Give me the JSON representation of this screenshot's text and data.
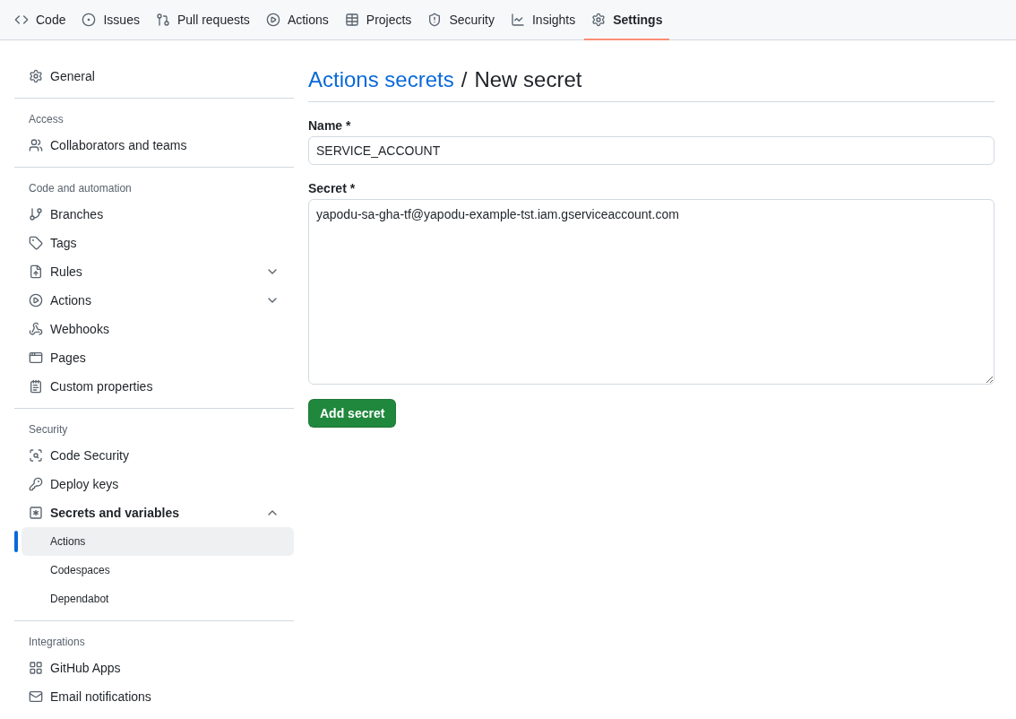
{
  "tabs": [
    {
      "label": "Code",
      "selected": false
    },
    {
      "label": "Issues",
      "selected": false
    },
    {
      "label": "Pull requests",
      "selected": false
    },
    {
      "label": "Actions",
      "selected": false
    },
    {
      "label": "Projects",
      "selected": false
    },
    {
      "label": "Security",
      "selected": false
    },
    {
      "label": "Insights",
      "selected": false
    },
    {
      "label": "Settings",
      "selected": true
    }
  ],
  "sidebar": {
    "sections": [
      {
        "items": [
          {
            "label": "General",
            "selected": false
          }
        ]
      },
      {
        "heading": "Access",
        "items": [
          {
            "label": "Collaborators and teams",
            "selected": false
          }
        ]
      },
      {
        "heading": "Code and automation",
        "items": [
          {
            "label": "Branches",
            "selected": false
          },
          {
            "label": "Tags",
            "selected": false
          },
          {
            "label": "Rules",
            "selected": false,
            "expanded": false
          },
          {
            "label": "Actions",
            "selected": false,
            "expanded": false
          },
          {
            "label": "Webhooks",
            "selected": false
          },
          {
            "label": "Pages",
            "selected": false
          },
          {
            "label": "Custom properties",
            "selected": false
          }
        ]
      },
      {
        "heading": "Security",
        "items": [
          {
            "label": "Code Security",
            "selected": false
          },
          {
            "label": "Deploy keys",
            "selected": false
          },
          {
            "label": "Secrets and variables",
            "selected": false,
            "expanded": true,
            "children": [
              {
                "label": "Actions",
                "selected": true
              },
              {
                "label": "Codespaces",
                "selected": false
              },
              {
                "label": "Dependabot",
                "selected": false
              }
            ]
          }
        ]
      },
      {
        "heading": "Integrations",
        "items": [
          {
            "label": "GitHub Apps",
            "selected": false
          },
          {
            "label": "Email notifications",
            "selected": false
          }
        ]
      }
    ]
  },
  "page": {
    "breadcrumb_link": "Actions secrets",
    "separator": "/",
    "title": "New secret"
  },
  "form": {
    "name_label": "Name *",
    "name_value": "SERVICE_ACCOUNT",
    "secret_label": "Secret *",
    "secret_value": "yapodu-sa-gha-tf@yapodu-example-tst.iam.gserviceaccount.com",
    "submit": "Add secret"
  }
}
